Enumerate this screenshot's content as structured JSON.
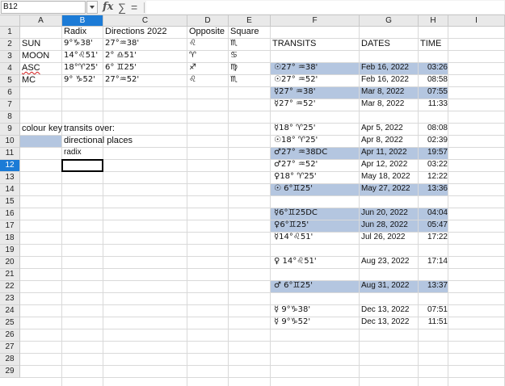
{
  "formula_bar": {
    "name_box": "B12",
    "fx_icon": "fx",
    "sum_icon": "∑",
    "equals_icon": "=",
    "content": ""
  },
  "columns": [
    "A",
    "B",
    "C",
    "D",
    "E",
    "F",
    "G",
    "H",
    "I"
  ],
  "selected_column": "B",
  "rows": [
    "1",
    "2",
    "3",
    "4",
    "5",
    "6",
    "7",
    "8",
    "9",
    "10",
    "11",
    "12",
    "13",
    "14",
    "15",
    "16",
    "17",
    "18",
    "19",
    "20",
    "21",
    "22",
    "23",
    "24",
    "25",
    "26",
    "27",
    "28",
    "29"
  ],
  "selected_row": "12",
  "highlight_color": "#b4c6e0",
  "selection_color": "#1c7bd6",
  "sheet": {
    "header": {
      "radix": "Radix",
      "directions": "Directions 2022",
      "opposite": "Opposite",
      "square": "Square"
    },
    "points": [
      {
        "name": "SUN",
        "radix": "9°♑38'",
        "directions": "27°♒38'",
        "opposite": "♌",
        "square": "♏"
      },
      {
        "name": "MOON",
        "radix": "14°♌51'",
        "directions": "2° ♎51'",
        "opposite": "♈",
        "square": "♋"
      },
      {
        "name": "ASC",
        "radix": "18°♈25'",
        "directions": "6° ♊25'",
        "opposite": "♐",
        "square": "♍"
      },
      {
        "name": "MC",
        "radix": "9° ♑52'",
        "directions": "27°♒52'",
        "opposite": "♌",
        "square": "♏"
      }
    ],
    "key": {
      "title": "colour key",
      "subtitle": "transits over:",
      "directional": "directional places",
      "radix": "radix"
    },
    "transits_header": {
      "transits": "TRANSITS",
      "dates": "DATES",
      "time": "TIME"
    },
    "transits": [
      {
        "row": 4,
        "transit": "☉27° ♒38'",
        "date": "Feb 16, 2022",
        "time": "03:26",
        "hl": true
      },
      {
        "row": 5,
        "transit": "☉27° ♒52'",
        "date": "Feb 16, 2022",
        "time": "08:58",
        "hl": false
      },
      {
        "row": 6,
        "transit": "☿27° ♒38'",
        "date": "Mar 8, 2022",
        "time": "07:55",
        "hl": true
      },
      {
        "row": 7,
        "transit": "☿27° ♒52'",
        "date": "Mar 8, 2022",
        "time": "11:33",
        "hl": false
      },
      {
        "row": 9,
        "transit": "☿18° ♈25'",
        "date": "Apr 5, 2022",
        "time": "08:08",
        "hl": false
      },
      {
        "row": 10,
        "transit": "☉18° ♈25'",
        "date": "Apr 8, 2022",
        "time": "02:39",
        "hl": false
      },
      {
        "row": 11,
        "transit": "♂27° ♒38DC",
        "date": "Apr 11, 2022",
        "time": "19:57",
        "hl": true
      },
      {
        "row": 12,
        "transit": "♂27° ♒52'",
        "date": "Apr 12, 2022",
        "time": "03:22",
        "hl": false
      },
      {
        "row": 13,
        "transit": "♀18° ♈25'",
        "date": "May 18, 2022",
        "time": "12:22",
        "hl": false
      },
      {
        "row": 14,
        "transit": "☉ 6°♊25'",
        "date": "May 27, 2022",
        "time": "13:36",
        "hl": true
      },
      {
        "row": 16,
        "transit": "☿6°♊25DC",
        "date": "Jun 20, 2022",
        "time": "04:04",
        "hl": true
      },
      {
        "row": 17,
        "transit": "♀6°♊25'",
        "date": "Jun 28, 2022",
        "time": "05:47",
        "hl": true
      },
      {
        "row": 18,
        "transit": "☿14°♌51'",
        "date": "Jul 26, 2022",
        "time": "17:22",
        "hl": false
      },
      {
        "row": 20,
        "transit": "♀ 14°♌51'",
        "date": "Aug 23, 2022",
        "time": "17:14",
        "hl": false
      },
      {
        "row": 22,
        "transit": "♂ 6°♊25'",
        "date": "Aug 31, 2022",
        "time": "13:37",
        "hl": true
      },
      {
        "row": 24,
        "transit": "☿ 9°♑38'",
        "date": "Dec 13, 2022",
        "time": "07:51",
        "hl": false
      },
      {
        "row": 25,
        "transit": "☿ 9°♑52'",
        "date": "Dec 13, 2022",
        "time": "11:51",
        "hl": false
      }
    ]
  }
}
